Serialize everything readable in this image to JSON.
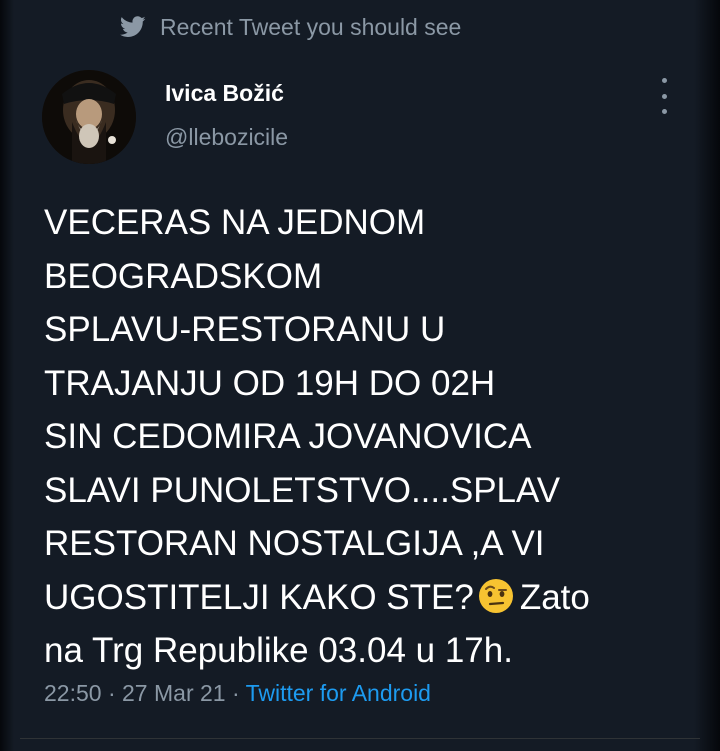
{
  "context": {
    "icon": "twitter-bird-icon",
    "text": "Recent Tweet you should see"
  },
  "author": {
    "name": "Ivica Božić",
    "handle": "@llebozicile"
  },
  "tweet": {
    "lines": [
      "VECERAS NA JEDNOM",
      "BEOGRADSKOM",
      "SPLAVU-RESTORANU U",
      "TRAJANJU OD 19H DO 02H",
      "SIN CEDOMIRA JOVANOVICA",
      "SLAVI PUNOLETSTVO....SPLAV",
      "RESTORAN NOSTALGIJA ,A VI"
    ],
    "line8_before_emoji": "UGOSTITELJI KAKO STE?",
    "emoji": "raised-eyebrow-face-emoji",
    "line8_after_emoji": "Zato",
    "line9": "na Trg Republike 03.04 u 17h."
  },
  "meta": {
    "time": "22:50",
    "separator": " · ",
    "date": "27 Mar 21",
    "separator2": " · ",
    "source": "Twitter for Android"
  },
  "colors": {
    "background": "#141b25",
    "text": "#ffffff",
    "muted": "#8b98a5",
    "link": "#1d9bf0"
  }
}
